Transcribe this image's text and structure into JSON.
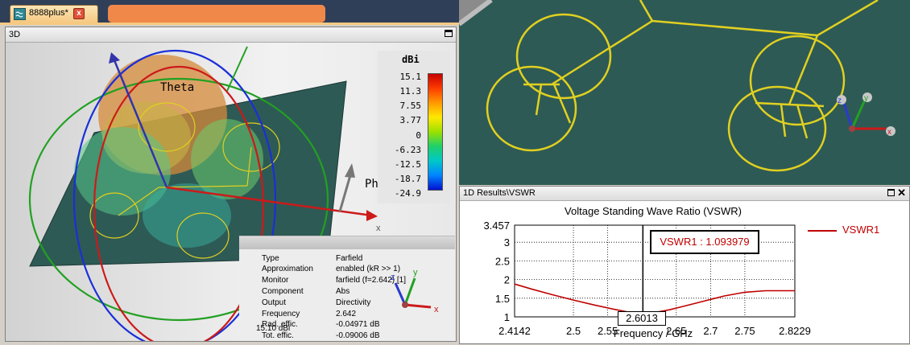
{
  "tab": {
    "label": "8888plus*",
    "close": "x"
  },
  "view3d": {
    "title": "3D",
    "axis_theta": "Theta",
    "axis_phi": "Phi",
    "axis_x": "x",
    "legend": {
      "unit": "dBi",
      "ticks": [
        "15.1",
        "11.3",
        "7.55",
        "3.77",
        "0",
        "-6.23",
        "-12.5",
        "-18.7",
        "-24.9"
      ]
    },
    "info": [
      {
        "label": "Type",
        "value": "Farfield"
      },
      {
        "label": "Approximation",
        "value": "enabled (kR >> 1)"
      },
      {
        "label": "Monitor",
        "value": "farfield (f=2.642) [1]"
      },
      {
        "label": "Component",
        "value": "Abs"
      },
      {
        "label": "Output",
        "value": "Directivity"
      },
      {
        "label": "Frequency",
        "value": "2.642"
      },
      {
        "label": "Rad. effic.",
        "value": "-0.04971 dB"
      },
      {
        "label": "Tot. effic.",
        "value": "-0.09006 dB"
      },
      {
        "label": "",
        "value": "15.10 dBi"
      }
    ],
    "mini_axes": {
      "z": "z",
      "y": "y",
      "x": "x"
    }
  },
  "topright": {
    "axes": {
      "z": "z",
      "y": "y",
      "x": "x"
    }
  },
  "vswr": {
    "window_title": "1D Results\\VSWR",
    "close": "✕",
    "chart_data": {
      "type": "line",
      "title": "Voltage Standing Wave Ratio (VSWR)",
      "xlabel": "Frequency / GHz",
      "ylabel": "",
      "xlim": [
        2.4142,
        2.8229
      ],
      "ylim": [
        1,
        3.457
      ],
      "x_ticks": [
        "2.4142",
        "2.5",
        "2.55",
        "2.6013",
        "2.65",
        "2.7",
        "2.75",
        "2.8229"
      ],
      "y_ticks": [
        "3.457",
        "3",
        "2.5",
        "2",
        "1.5",
        "1"
      ],
      "grid": true,
      "legend_position": "right",
      "series": [
        {
          "name": "VSWR1",
          "color": "#c00000",
          "x": [
            2.4142,
            2.44,
            2.47,
            2.5,
            2.53,
            2.56,
            2.58,
            2.6013,
            2.62,
            2.64,
            2.66,
            2.69,
            2.72,
            2.75,
            2.78,
            2.8229
          ],
          "y": [
            1.88,
            1.74,
            1.59,
            1.45,
            1.32,
            1.2,
            1.13,
            1.094,
            1.12,
            1.19,
            1.28,
            1.42,
            1.56,
            1.66,
            1.7,
            1.7
          ]
        }
      ],
      "marker": {
        "x": 2.6013,
        "label": "VSWR1 : 1.093979",
        "x_label": "2.6013"
      }
    }
  },
  "colors": {
    "plane": "#2e5a55",
    "dipole": "#e0d020",
    "accent": "#c00000"
  }
}
